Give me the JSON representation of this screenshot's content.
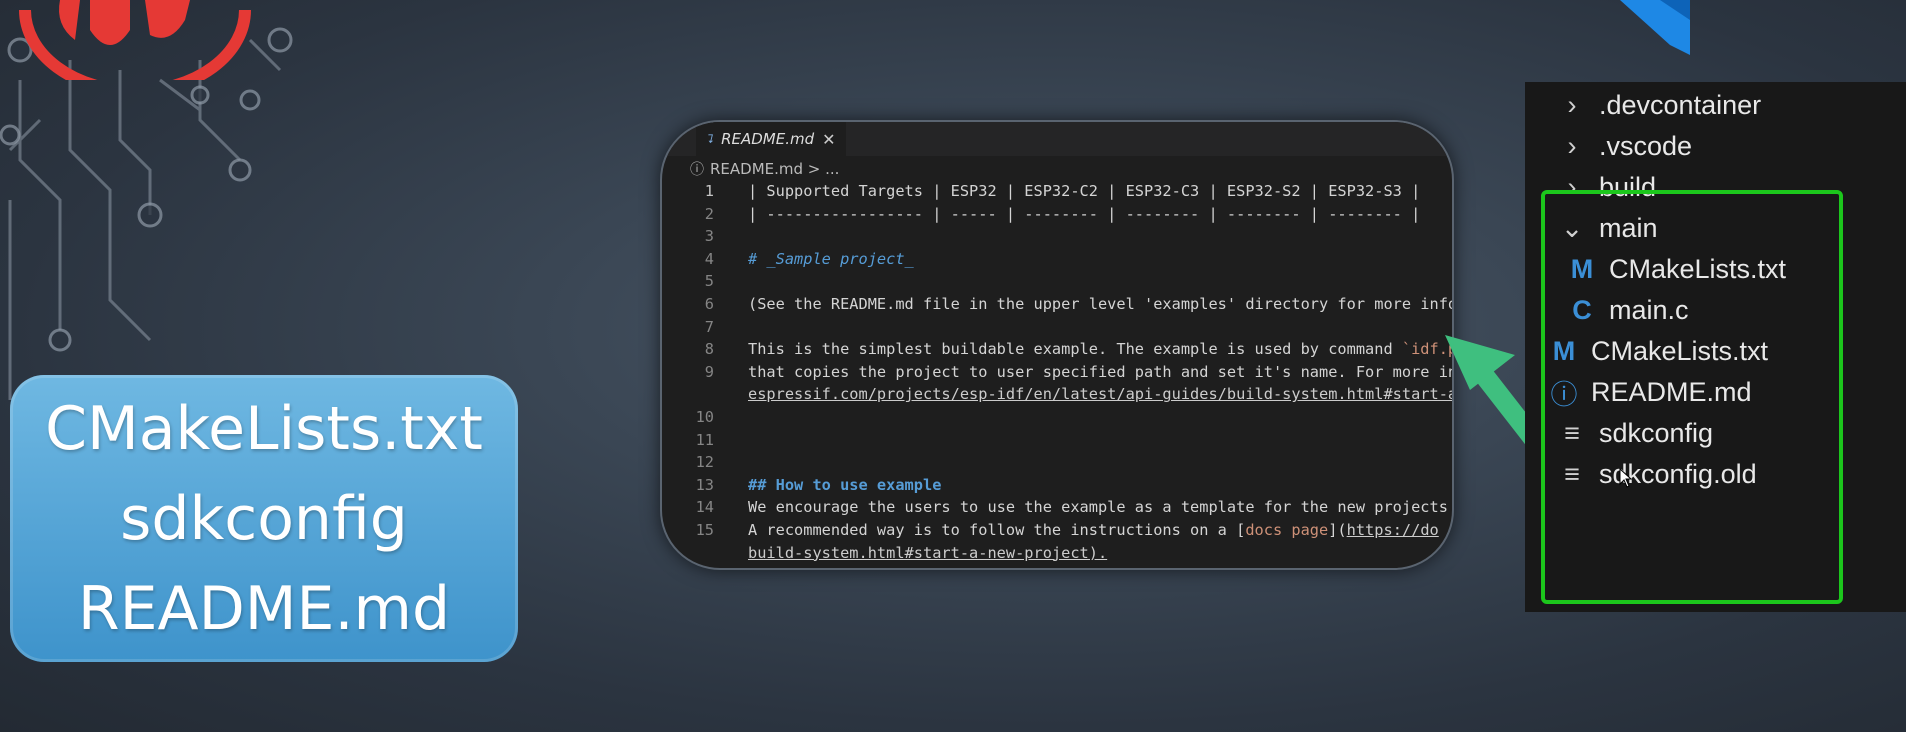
{
  "label_card": {
    "lines": [
      "CMakeLists.txt",
      "sdkconfig",
      "README.md"
    ]
  },
  "editor": {
    "tab_label": "README.md",
    "tab_close": "✕",
    "breadcrumb": "README.md > ...",
    "lines": [
      {
        "n": "1",
        "text": "| Supported Targets | ESP32 | ESP32-C2 | ESP32-C3 | ESP32-S2 | ESP32-S3 |"
      },
      {
        "n": "2",
        "text": "| ----------------- | ----- | -------- | -------- | -------- | -------- |"
      },
      {
        "n": "3",
        "text": ""
      },
      {
        "n": "4",
        "text": "# _Sample project_"
      },
      {
        "n": "5",
        "text": ""
      },
      {
        "n": "6",
        "text": "(See the README.md file in the upper level 'examples' directory for more info"
      },
      {
        "n": "7",
        "text": ""
      },
      {
        "n": "8",
        "text": "This is the simplest buildable example. The example is used by command `idf.p"
      },
      {
        "n": "9",
        "text": "that copies the project to user specified path and set it's name. For more in"
      },
      {
        "n": "",
        "text": "espressif.com/projects/esp-idf/en/latest/api-guides/build-system.html#start-a"
      },
      {
        "n": "10",
        "text": ""
      },
      {
        "n": "11",
        "text": ""
      },
      {
        "n": "12",
        "text": ""
      },
      {
        "n": "13",
        "text": "## How to use example"
      },
      {
        "n": "14",
        "text": "We encourage the users to use the example as a template for the new projects"
      },
      {
        "n": "15",
        "text": "A recommended way is to follow the instructions on a [docs page](https://do"
      },
      {
        "n": "",
        "text": "build-system.html#start-a-new-project)."
      }
    ]
  },
  "explorer": {
    "items": [
      {
        "icon": "chevron-right-icon",
        "glyph": "›",
        "label": ".devcontainer"
      },
      {
        "icon": "chevron-right-icon",
        "glyph": "›",
        "label": ".vscode"
      },
      {
        "icon": "chevron-right-icon",
        "glyph": "›",
        "label": "build"
      },
      {
        "icon": "chevron-down-icon",
        "glyph": "⌄",
        "label": "main"
      },
      {
        "icon": "cmake-file-icon",
        "glyph": "M",
        "label": "CMakeLists.txt"
      },
      {
        "icon": "c-file-icon",
        "glyph": "C",
        "label": "main.c"
      },
      {
        "icon": "cmake-file-icon",
        "glyph": "M",
        "label": "CMakeLists.txt"
      },
      {
        "icon": "info-file-icon",
        "glyph": "ⓘ",
        "label": "README.md"
      },
      {
        "icon": "text-file-icon",
        "glyph": "≡",
        "label": "sdkconfig"
      },
      {
        "icon": "text-file-icon",
        "glyph": "≡",
        "label": "sdkconfig.old"
      }
    ]
  },
  "colors": {
    "highlight_box": "#1cc61c",
    "arrow": "#3fbf7f",
    "card": "#4fa3d6"
  }
}
